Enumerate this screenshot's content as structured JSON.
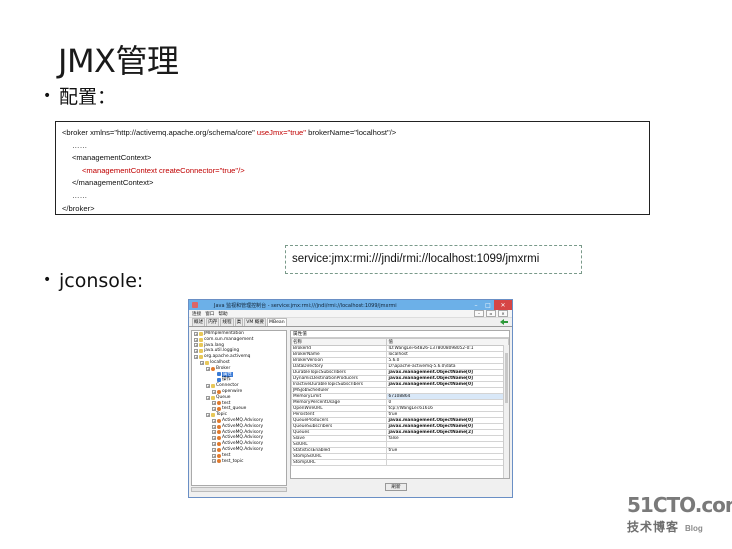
{
  "slide": {
    "title": "JMX管理",
    "bullet1": "配置：",
    "bullet2": "jconsole:",
    "bullet_dot": "•"
  },
  "code": {
    "l1_a": "<broker xmlns=\"http://activemq.apache.org/schema/core\" ",
    "l1_b": "useJmx=\"true\"",
    "l1_c": " brokerName=\"localhost\"/>",
    "l2": "……",
    "l3": "<managementContext>",
    "l4": "<managementContext createConnector=\"true\"/>",
    "l5": "</managementContext>",
    "l6": "……",
    "l7": "</broker>",
    "highlight_color": "#c00000"
  },
  "service_url": "service:jmx:rmi:///jndi/rmi://localhost:1099/jmxrmi",
  "jconsole": {
    "title": "Java 监视和管理控制台 - service:jmx:rmi:///jndi/rmi://localhost:1099/jmxrmi",
    "title_color": "#6cb0e8",
    "menu": [
      "连接",
      "窗口",
      "帮助"
    ],
    "tabs": [
      "概述",
      "内存",
      "线程",
      "类",
      "VM 概要",
      "MBean"
    ],
    "active_tab": "MBean",
    "tree": [
      {
        "label": "JMImplementation",
        "depth": 0,
        "icon": "folder"
      },
      {
        "label": "com.sun.management",
        "depth": 0,
        "icon": "folder"
      },
      {
        "label": "java.lang",
        "depth": 0,
        "icon": "folder"
      },
      {
        "label": "java.util.logging",
        "depth": 0,
        "icon": "folder"
      },
      {
        "label": "org.apache.activemq",
        "depth": 0,
        "icon": "folder"
      },
      {
        "label": "localhost",
        "depth": 1,
        "icon": "folder"
      },
      {
        "label": "Broker",
        "depth": 2,
        "icon": "bean"
      },
      {
        "label": "属性",
        "depth": 3,
        "icon": "blue",
        "selected": true
      },
      {
        "label": "操作",
        "depth": 3,
        "icon": "blue"
      },
      {
        "label": "Connector",
        "depth": 2,
        "icon": "folder"
      },
      {
        "label": "openwire",
        "depth": 3,
        "icon": "bean"
      },
      {
        "label": "Queue",
        "depth": 2,
        "icon": "folder"
      },
      {
        "label": "test",
        "depth": 3,
        "icon": "bean"
      },
      {
        "label": "test_queue",
        "depth": 3,
        "icon": "bean"
      },
      {
        "label": "Topic",
        "depth": 2,
        "icon": "folder"
      },
      {
        "label": "ActiveMQ.Advisory",
        "depth": 3,
        "icon": "bean"
      },
      {
        "label": "ActiveMQ.Advisory",
        "depth": 3,
        "icon": "bean"
      },
      {
        "label": "ActiveMQ.Advisory",
        "depth": 3,
        "icon": "bean"
      },
      {
        "label": "ActiveMQ.Advisory",
        "depth": 3,
        "icon": "bean"
      },
      {
        "label": "ActiveMQ.Advisory",
        "depth": 3,
        "icon": "bean"
      },
      {
        "label": "ActiveMQ.Advisory",
        "depth": 3,
        "icon": "bean"
      },
      {
        "label": "test",
        "depth": 3,
        "icon": "bean"
      },
      {
        "label": "test_topic",
        "depth": 3,
        "icon": "bean"
      }
    ],
    "panel_title": "属性值",
    "col_name": "名称",
    "col_value": "值",
    "attributes": [
      {
        "name": "BrokerId",
        "value": "ID:WangLei-64826-1378008098052-0:1",
        "bold": false
      },
      {
        "name": "BrokerName",
        "value": "localhost",
        "bold": false
      },
      {
        "name": "BrokerVersion",
        "value": "5.6.0",
        "bold": false
      },
      {
        "name": "DataDirectory",
        "value": "D:\\apache-activemq-5.6.0\\data",
        "bold": false
      },
      {
        "name": "DurableTopicSubscribers",
        "value": "javax.management.ObjectName[0]",
        "bold": true
      },
      {
        "name": "DynamicDestinationProducers",
        "value": "javax.management.ObjectName[0]",
        "bold": true
      },
      {
        "name": "InactiveDurableTopicSubscribers",
        "value": "javax.management.ObjectName[0]",
        "bold": true
      },
      {
        "name": "JMSJobScheduler",
        "value": "",
        "bold": false
      },
      {
        "name": "MemoryLimit",
        "value": "67108864",
        "bold": false,
        "hl": true
      },
      {
        "name": "MemoryPercentUsage",
        "value": "0",
        "bold": false
      },
      {
        "name": "OpenWireURL",
        "value": "tcp://WangLei:61616",
        "bold": false
      },
      {
        "name": "Persistent",
        "value": "true",
        "bold": false
      },
      {
        "name": "QueueProducers",
        "value": "javax.management.ObjectName[0]",
        "bold": true
      },
      {
        "name": "QueueSubscribers",
        "value": "javax.management.ObjectName[0]",
        "bold": true
      },
      {
        "name": "Queues",
        "value": "javax.management.ObjectName[2]",
        "bold": true
      },
      {
        "name": "Slave",
        "value": "false",
        "bold": false
      },
      {
        "name": "SslURL",
        "value": "",
        "bold": false
      },
      {
        "name": "StatisticsEnabled",
        "value": "true",
        "bold": false
      },
      {
        "name": "StompSslURL",
        "value": "",
        "bold": false
      },
      {
        "name": "StompURL",
        "value": "",
        "bold": false
      }
    ],
    "refresh_label": "刷新"
  },
  "watermark": {
    "site": "51CTO.com",
    "cn": "技术博客",
    "blog": "Blog"
  }
}
